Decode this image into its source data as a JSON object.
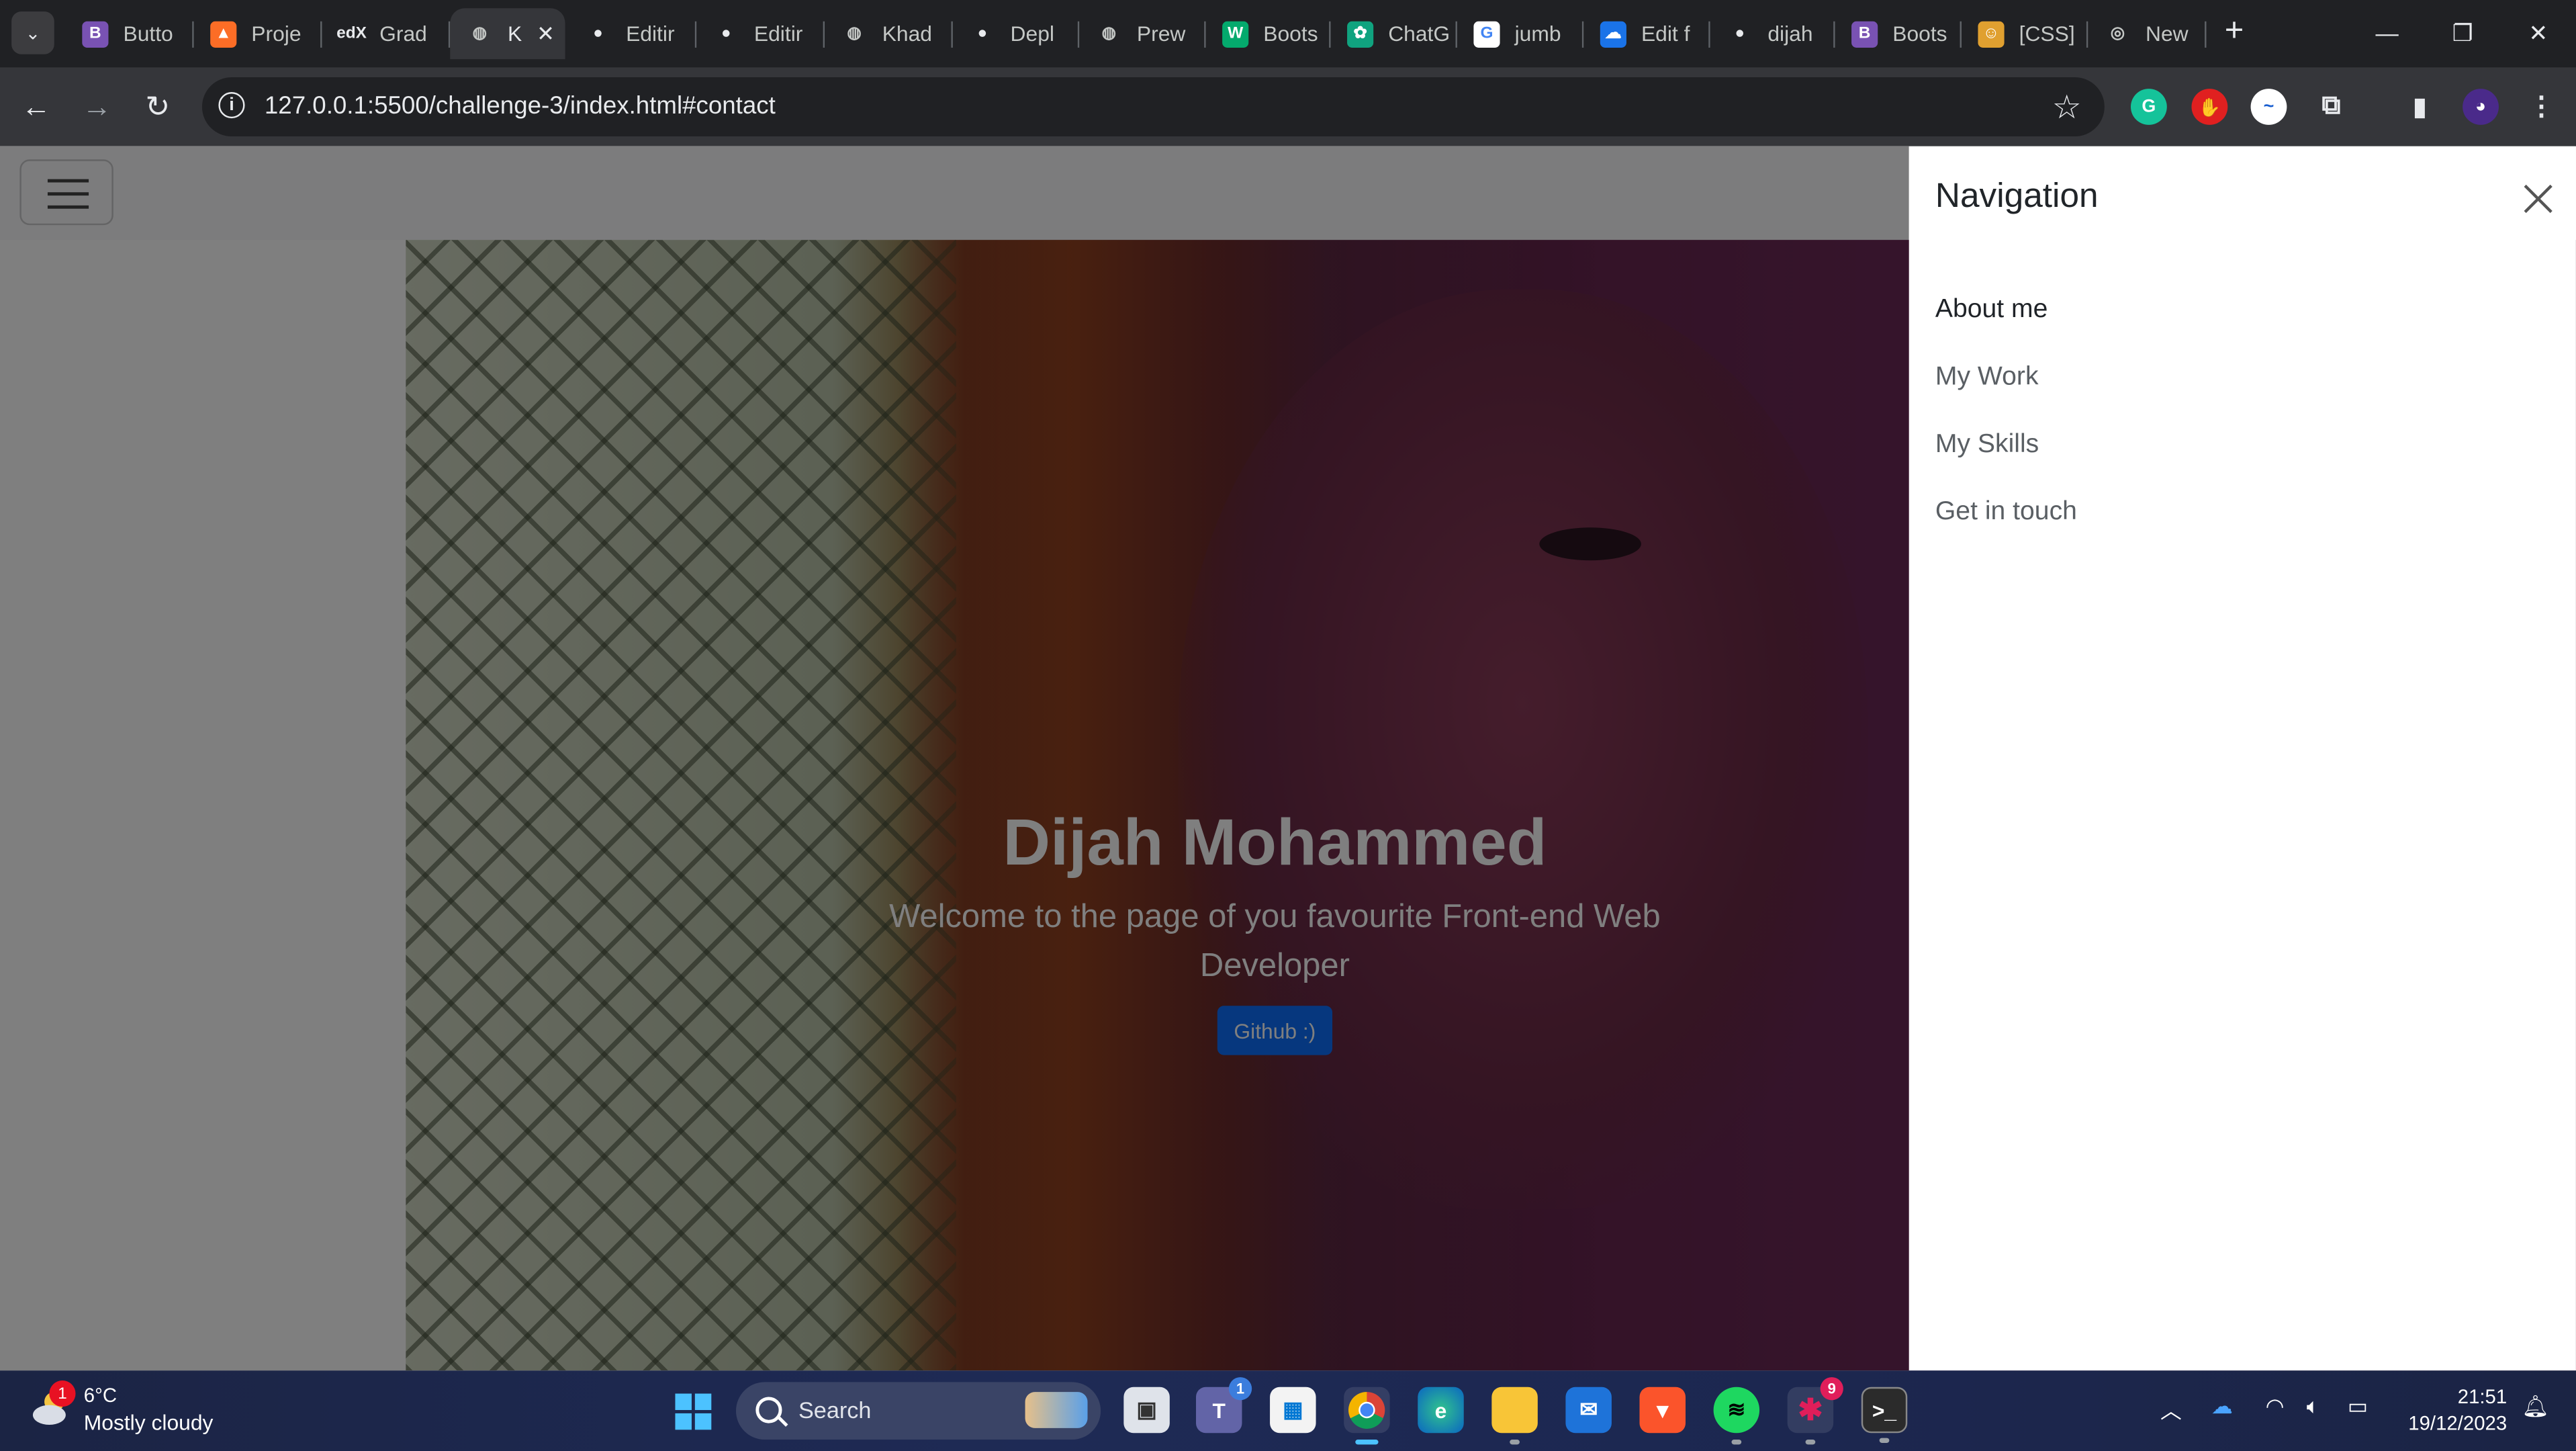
{
  "browser": {
    "tabs": [
      {
        "label": "Butto",
        "icon": "bootstrap-icon",
        "color": "#7952b3",
        "glyph": "B"
      },
      {
        "label": "Proje",
        "icon": "gitlab-icon",
        "color": "#fc6d26",
        "glyph": "▲"
      },
      {
        "label": "Grad",
        "icon": "edx-icon",
        "color": "#202124",
        "glyph": "edX"
      },
      {
        "label": "K",
        "icon": "globe-icon",
        "color": "#9aa0a6",
        "glyph": "◍",
        "active": true
      },
      {
        "label": "Editir",
        "icon": "github-icon",
        "color": "#202124",
        "glyph": "●"
      },
      {
        "label": "Editir",
        "icon": "github-icon",
        "color": "#202124",
        "glyph": "●"
      },
      {
        "label": "Khad",
        "icon": "globe-icon",
        "color": "#9aa0a6",
        "glyph": "◍"
      },
      {
        "label": "Depl",
        "icon": "github-icon",
        "color": "#202124",
        "glyph": "●"
      },
      {
        "label": "Prew",
        "icon": "globe-icon",
        "color": "#9aa0a6",
        "glyph": "◍"
      },
      {
        "label": "Boots",
        "icon": "w3schools-icon",
        "color": "#04aa6d",
        "glyph": "W"
      },
      {
        "label": "ChatG",
        "icon": "chatgpt-icon",
        "color": "#10a37f",
        "glyph": "✿"
      },
      {
        "label": "jumb",
        "icon": "google-icon",
        "color": "#ffffff",
        "glyph": "G"
      },
      {
        "label": "Edit f",
        "icon": "cloud-icon",
        "color": "#1a73e8",
        "glyph": "☁"
      },
      {
        "label": "dijah",
        "icon": "github-icon",
        "color": "#202124",
        "glyph": "●"
      },
      {
        "label": "Boots",
        "icon": "bootstrap-icon",
        "color": "#7952b3",
        "glyph": "B"
      },
      {
        "label": "[CSS]",
        "icon": "avatar-icon",
        "color": "#e0a030",
        "glyph": "☺"
      },
      {
        "label": "New",
        "icon": "chrome-icon",
        "color": "#9aa0a6",
        "glyph": "◎"
      }
    ],
    "url": "127.0.0.1:5500/challenge-3/index.html#contact"
  },
  "page": {
    "hero_title": "Dijah Mohammed",
    "hero_subtitle": "Welcome to the page of you favourite Front-end Web Developer",
    "github_button": "Github :)"
  },
  "offcanvas": {
    "title": "Navigation",
    "links": [
      "About me",
      "My Work",
      "My Skills",
      "Get in touch"
    ]
  },
  "taskbar": {
    "weather": {
      "badge": "1",
      "temp": "6°C",
      "desc": "Mostly cloudy"
    },
    "search_label": "Search",
    "teams_badge": "1",
    "slack_badge": "9",
    "time": "21:51",
    "date": "19/12/2023"
  },
  "colors": {
    "primary": "#0d6efd",
    "chrome_bg": "#202124",
    "toolbar_bg": "#35363a"
  }
}
